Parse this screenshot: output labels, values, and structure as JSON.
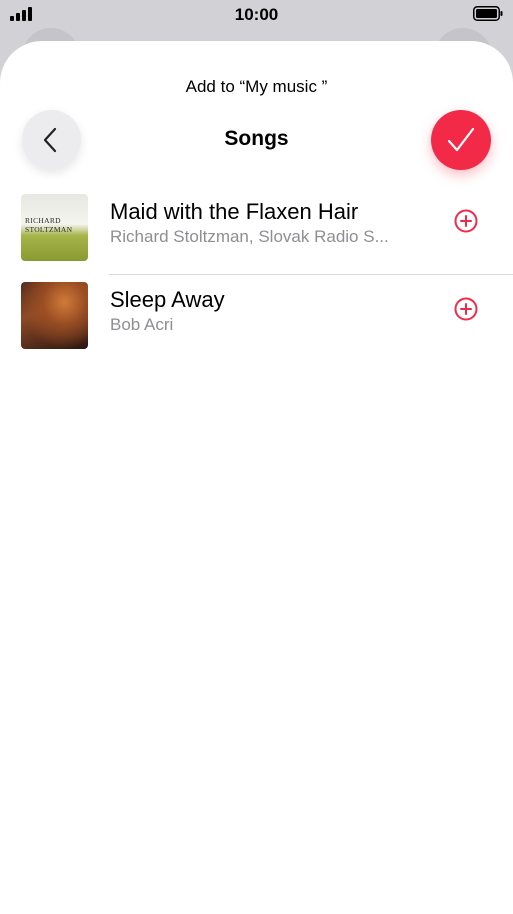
{
  "status_bar": {
    "time": "10:00"
  },
  "sheet": {
    "subtitle": "Add to “My music ”",
    "title": "Songs",
    "back_icon": "chevron-left-icon",
    "done_icon": "checkmark-icon"
  },
  "songs": [
    {
      "title": "Maid with the Flaxen Hair",
      "artist": "Richard Stoltzman, Slovak Radio S...",
      "artwork_text": "RICHARD STOLTZMAN"
    },
    {
      "title": "Sleep Away",
      "artist": "Bob Acri"
    }
  ],
  "colors": {
    "accent": "#f22a47",
    "secondary_text": "#8e8e93"
  }
}
